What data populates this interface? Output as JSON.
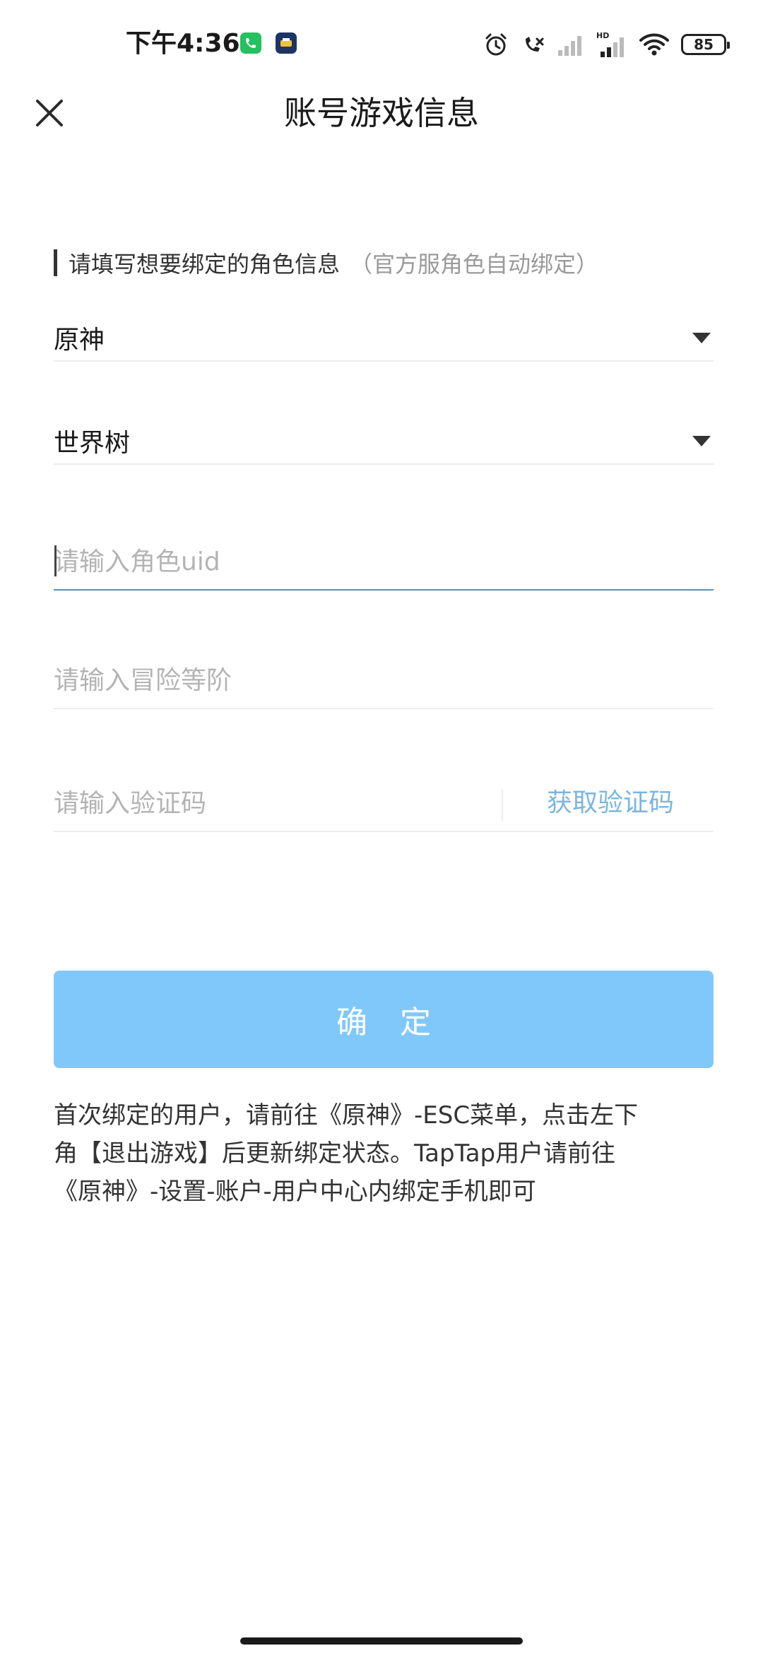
{
  "status_bar": {
    "time": "下午4:36",
    "battery": "85",
    "network_label": "HD",
    "icons": [
      "phone-app-icon",
      "app-notification-icon",
      "alarm-icon",
      "call-status-icon",
      "signal-icon",
      "signal-hd-icon",
      "wifi-icon",
      "battery-icon"
    ]
  },
  "header": {
    "title": "账号游戏信息",
    "close_icon": "close-icon"
  },
  "form": {
    "section_label": "请填写想要绑定的角色信息",
    "section_hint": "（官方服角色自动绑定）",
    "game_select": "原神",
    "server_select": "世界树",
    "uid_placeholder": "请输入角色uid",
    "rank_placeholder": "请输入冒险等阶",
    "code_placeholder": "请输入验证码",
    "get_code_label": "获取验证码"
  },
  "confirm_label": "确 定",
  "notice": "首次绑定的用户，请前往《原神》-ESC菜单，点击左下\n角【退出游戏】后更新绑定状态。TapTap用户请前往\n《原神》-设置-账户-用户中心内绑定手机即可",
  "colors": {
    "accent": "#80c8fa",
    "link": "#7ab6df",
    "focus_underline": "#5b8fb0"
  }
}
